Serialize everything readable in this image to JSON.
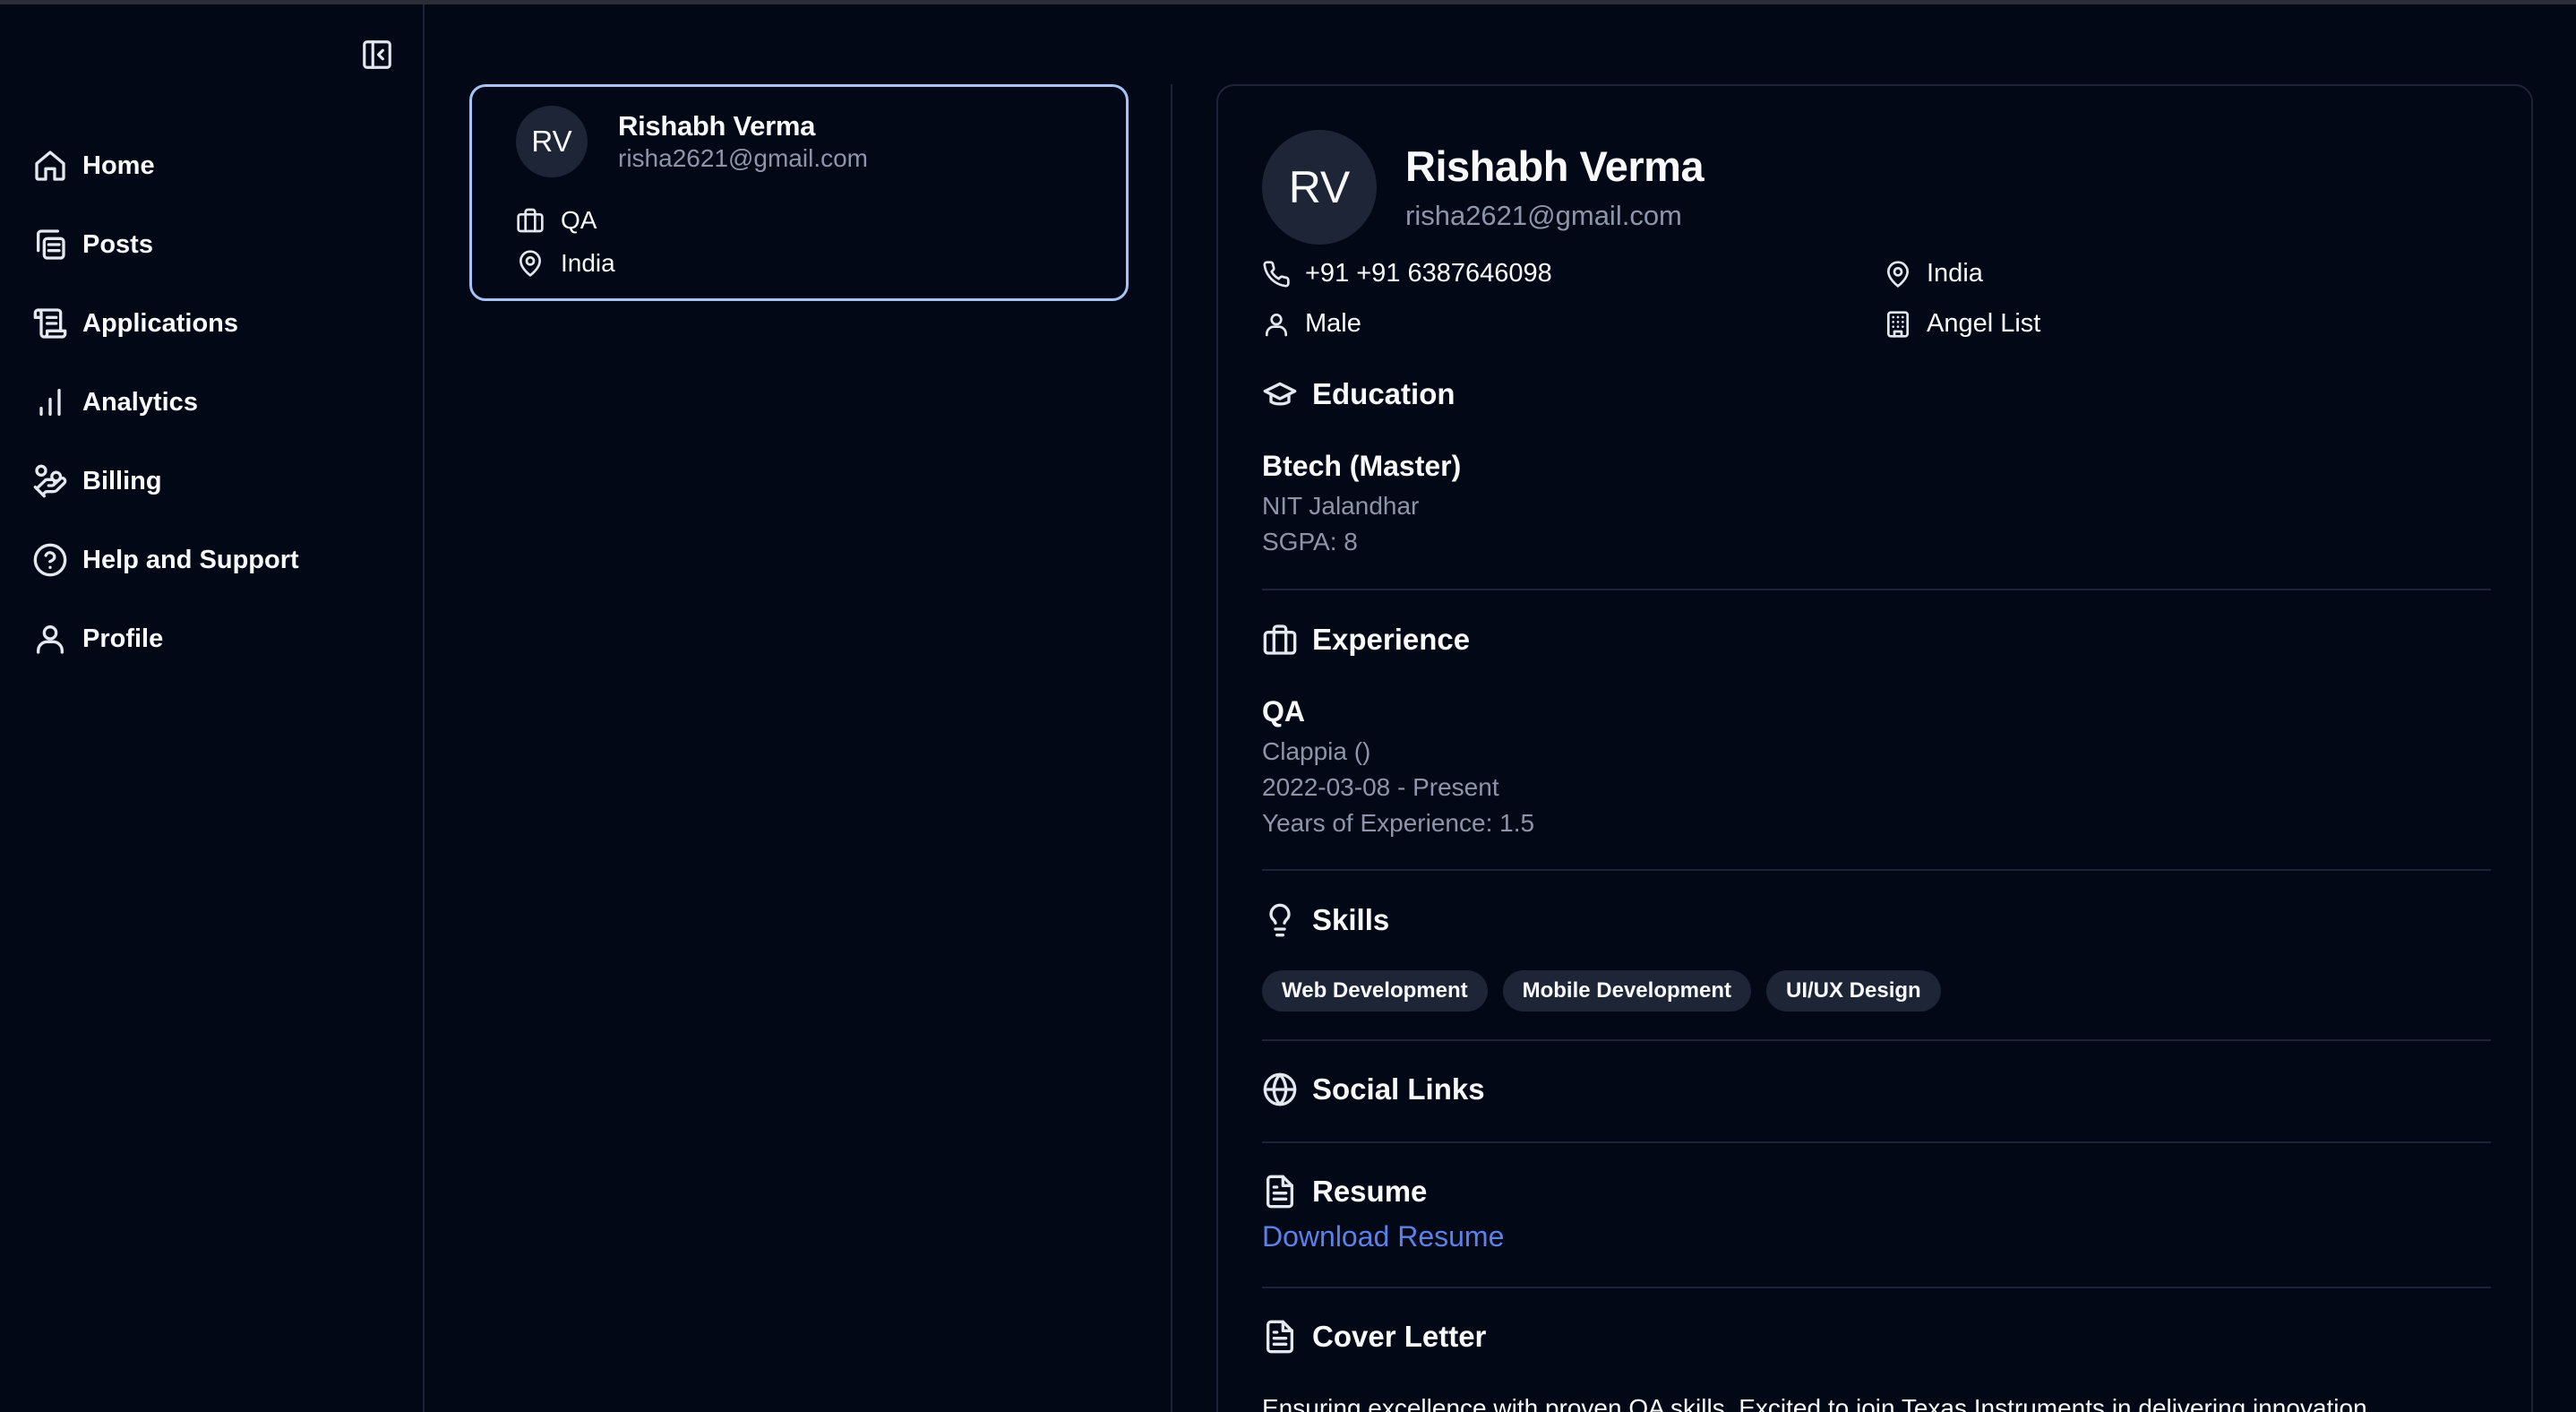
{
  "sidebar": {
    "collapse_icon": "panel-left-close-icon",
    "items": [
      {
        "label": "Home",
        "icon": "home-icon"
      },
      {
        "label": "Posts",
        "icon": "copy-icon"
      },
      {
        "label": "Applications",
        "icon": "scroll-icon"
      },
      {
        "label": "Analytics",
        "icon": "bar-chart-icon"
      },
      {
        "label": "Billing",
        "icon": "hand-coins-icon"
      },
      {
        "label": "Help and Support",
        "icon": "help-circle-icon"
      },
      {
        "label": "Profile",
        "icon": "user-icon"
      }
    ]
  },
  "candidate_list": [
    {
      "initials": "RV",
      "name": "Rishabh Verma",
      "email": "risha2621@gmail.com",
      "role": "QA",
      "location": "India"
    }
  ],
  "detail": {
    "initials": "RV",
    "name": "Rishabh Verma",
    "email": "risha2621@gmail.com",
    "phone": "+91 +91 6387646098",
    "location": "India",
    "gender": "Male",
    "company": "Angel List",
    "education": {
      "heading": "Education",
      "degree": "Btech (Master)",
      "institute": "NIT Jalandhar",
      "sgpa": "SGPA: 8"
    },
    "experience": {
      "heading": "Experience",
      "role": "QA",
      "company": "Clappia ()",
      "period": "2022-03-08 - Present",
      "years": "Years of Experience: 1.5"
    },
    "skills": {
      "heading": "Skills",
      "items": [
        "Web Development",
        "Mobile Development",
        "UI/UX Design"
      ]
    },
    "social_links": {
      "heading": "Social Links"
    },
    "resume": {
      "heading": "Resume",
      "link_label": "Download Resume"
    },
    "cover_letter": {
      "heading": "Cover Letter",
      "text": "Ensuring excellence with proven QA skills. Excited to join Texas Instruments in delivering innovation"
    }
  },
  "colors": {
    "background": "#030817",
    "border": "#1c2537",
    "selected_border": "#a5c4f3",
    "muted_text": "#8d96a8",
    "link": "#5b82e8",
    "chip_bg": "#1e2536"
  }
}
